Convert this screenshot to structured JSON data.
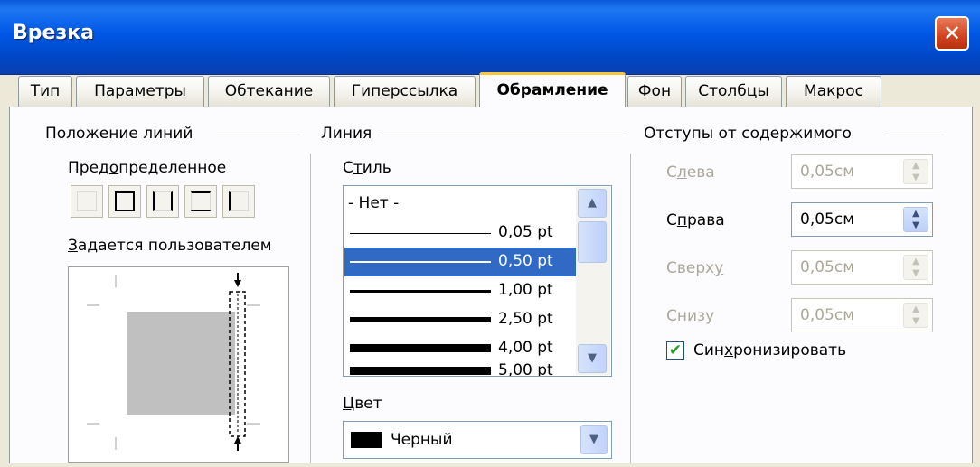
{
  "window": {
    "title": "Врезка"
  },
  "tabs": [
    {
      "label": "Тип"
    },
    {
      "label": "Параметры"
    },
    {
      "label": "Обтекание"
    },
    {
      "label": "Гиперссылка"
    },
    {
      "label": "Обрамление"
    },
    {
      "label": "Фон"
    },
    {
      "label": "Столбцы"
    },
    {
      "label": "Макрос"
    }
  ],
  "line_position": {
    "heading": "Положение линий",
    "preset_label_parts": [
      "Пред",
      "о",
      "пределенное"
    ],
    "custom_label_parts": [
      "З",
      "адается пользователем"
    ]
  },
  "line": {
    "heading": "Линия",
    "style_label_parts": [
      "С",
      "т",
      "иль"
    ],
    "styles": [
      {
        "label": "- Нет -"
      },
      {
        "label": "0,05 pt"
      },
      {
        "label": "0,50 pt"
      },
      {
        "label": "1,00 pt"
      },
      {
        "label": "2,50 pt"
      },
      {
        "label": "4,00 pt"
      },
      {
        "label": "5,00 pt"
      }
    ],
    "selected_style": "0,50 pt",
    "color_label_parts": [
      "Ц",
      "вет"
    ],
    "color_value": "Черный",
    "color_swatch": "#000000"
  },
  "spacing": {
    "heading": "Отступы от содержимого",
    "left": {
      "label_parts": [
        "С",
        "л",
        "ева"
      ],
      "value": "0,05см"
    },
    "right": {
      "label_parts": [
        "С",
        "п",
        "рава"
      ],
      "value": "0,05см"
    },
    "top": {
      "label_parts": [
        "Сверх",
        "у",
        ""
      ],
      "value": "0,05см"
    },
    "bottom": {
      "label_parts": [
        "С",
        "н",
        "изу"
      ],
      "value": "0,05см"
    },
    "sync_label_parts": [
      "Син",
      "х",
      "ронизировать"
    ],
    "sync_checked": true
  },
  "colors": {
    "titlebar": "#0058E6",
    "selection": "#316AC5",
    "active_tab_accent": "#FFC83C"
  }
}
